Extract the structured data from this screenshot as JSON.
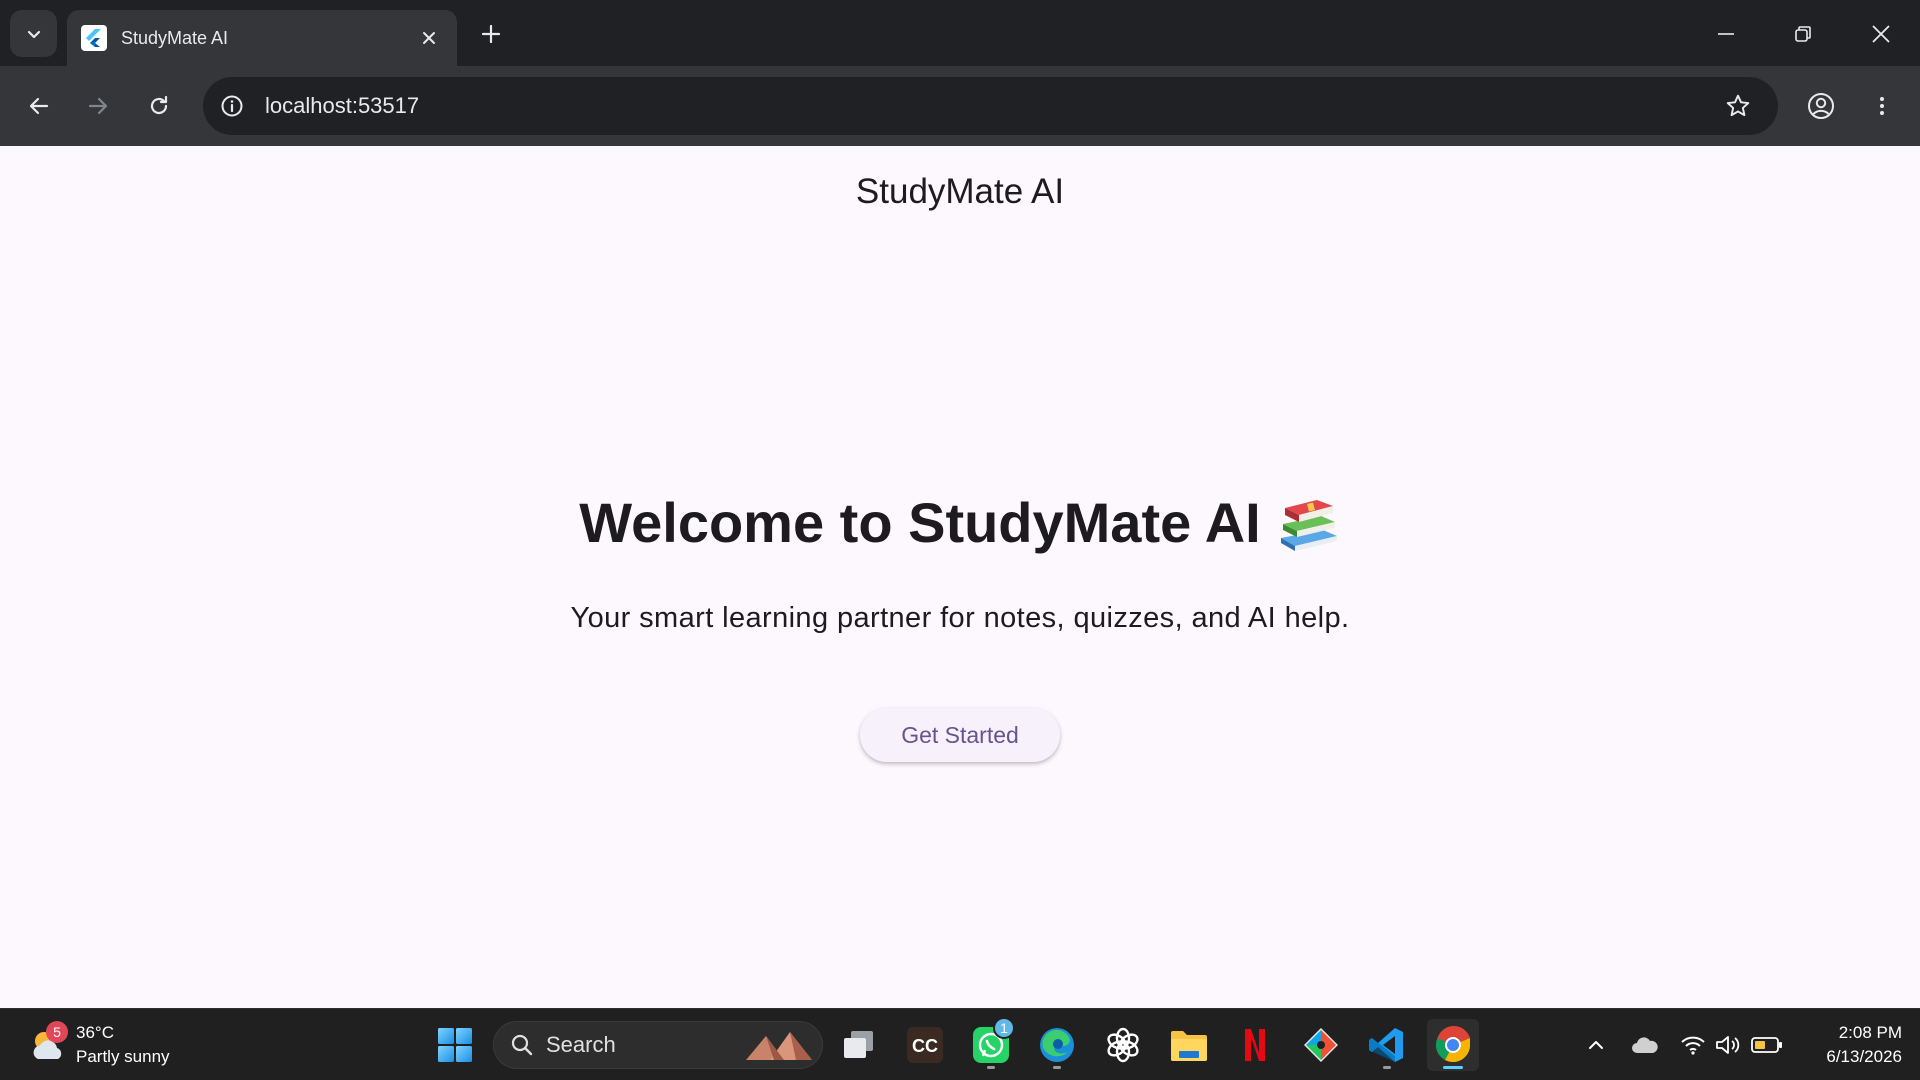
{
  "browser": {
    "tab_title": "StudyMate AI",
    "url": "localhost:53517",
    "icons": [
      "tab-search-icon",
      "flutter-icon",
      "close-icon",
      "plus-icon",
      "minimize-icon",
      "restore-icon",
      "close-window-icon",
      "back-arrow-icon",
      "forward-arrow-icon",
      "reload-icon",
      "info-icon",
      "star-icon",
      "profile-icon",
      "more-vert-icon"
    ]
  },
  "app": {
    "appbar_title": "StudyMate AI",
    "welcome_title": "Welcome to StudyMate AI",
    "welcome_emoji_icon": "books-icon",
    "subtitle": "Your smart learning partner for notes, quizzes, and AI help.",
    "cta_label": "Get Started",
    "colors": {
      "background": "#fdf7fe",
      "text": "#1d1b20",
      "button_text": "#65558f",
      "button_bg": "#f7f1fb"
    }
  },
  "taskbar": {
    "weather": {
      "temp": "36°C",
      "condition": "Partly sunny",
      "badge": "5"
    },
    "search_placeholder": "Search",
    "whatsapp_badge": "1",
    "clock": {
      "time": "2:08 PM",
      "date": "6/13/2026"
    },
    "apps": [
      "windows-start-icon",
      "search-icon",
      "task-view-icon",
      "capcut-icon",
      "whatsapp-icon",
      "edge-icon",
      "chatgpt-icon",
      "file-explorer-icon",
      "netflix-icon",
      "git-icon",
      "vscode-icon",
      "chrome-icon"
    ],
    "tray": [
      "chevron-up-icon",
      "onedrive-icon",
      "wifi-icon",
      "volume-icon",
      "battery-icon"
    ]
  }
}
